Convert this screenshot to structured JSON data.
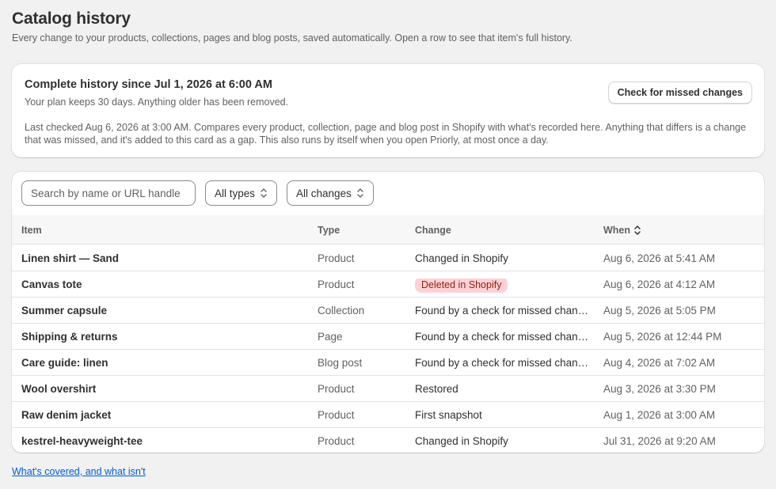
{
  "page": {
    "title": "Catalog history",
    "subtitle": "Every change to your products, collections, pages and blog posts, saved automatically. Open a row to see that item's full history."
  },
  "summary": {
    "title": "Complete history since Jul 1, 2026 at 6:00 AM",
    "plan_note": "Your plan keeps 30 days. Anything older has been removed.",
    "description": "Last checked Aug 6, 2026 at 3:00 AM. Compares every product, collection, page and blog post in Shopify with what's recorded here. Anything that differs is a change that was missed, and it's added to this card as a gap. This also runs by itself when you open Priorly, at most once a day.",
    "check_button": "Check for missed changes"
  },
  "filters": {
    "search_placeholder": "Search by name or URL handle",
    "type_filter": "All types",
    "change_filter": "All changes"
  },
  "table": {
    "columns": {
      "item": "Item",
      "type": "Type",
      "change": "Change",
      "when": "When"
    },
    "rows": [
      {
        "item": "Linen shirt — Sand",
        "type": "Product",
        "change": "Changed in Shopify",
        "when": "Aug 6, 2026 at 5:41 AM",
        "badge": false
      },
      {
        "item": "Canvas tote",
        "type": "Product",
        "change": "Deleted in Shopify",
        "when": "Aug 6, 2026 at 4:12 AM",
        "badge": true
      },
      {
        "item": "Summer capsule",
        "type": "Collection",
        "change": "Found by a check for missed changes",
        "when": "Aug 5, 2026 at 5:05 PM",
        "badge": false
      },
      {
        "item": "Shipping & returns",
        "type": "Page",
        "change": "Found by a check for missed changes",
        "when": "Aug 5, 2026 at 12:44 PM",
        "badge": false
      },
      {
        "item": "Care guide: linen",
        "type": "Blog post",
        "change": "Found by a check for missed changes",
        "when": "Aug 4, 2026 at 7:02 AM",
        "badge": false
      },
      {
        "item": "Wool overshirt",
        "type": "Product",
        "change": "Restored",
        "when": "Aug 3, 2026 at 3:30 PM",
        "badge": false
      },
      {
        "item": "Raw denim jacket",
        "type": "Product",
        "change": "First snapshot",
        "when": "Aug 1, 2026 at 3:00 AM",
        "badge": false
      },
      {
        "item": "kestrel-heavyweight-tee",
        "type": "Product",
        "change": "Changed in Shopify",
        "when": "Jul 31, 2026 at 9:20 AM",
        "badge": false
      }
    ]
  },
  "footer": {
    "link": "What's covered, and what isn't"
  },
  "icons": {
    "select": "chevron-up-down-icon",
    "sort": "sort-icon"
  },
  "colors": {
    "link": "#005bd3",
    "badge_bg": "#fed1d7",
    "badge_text": "#8e1f0b"
  }
}
